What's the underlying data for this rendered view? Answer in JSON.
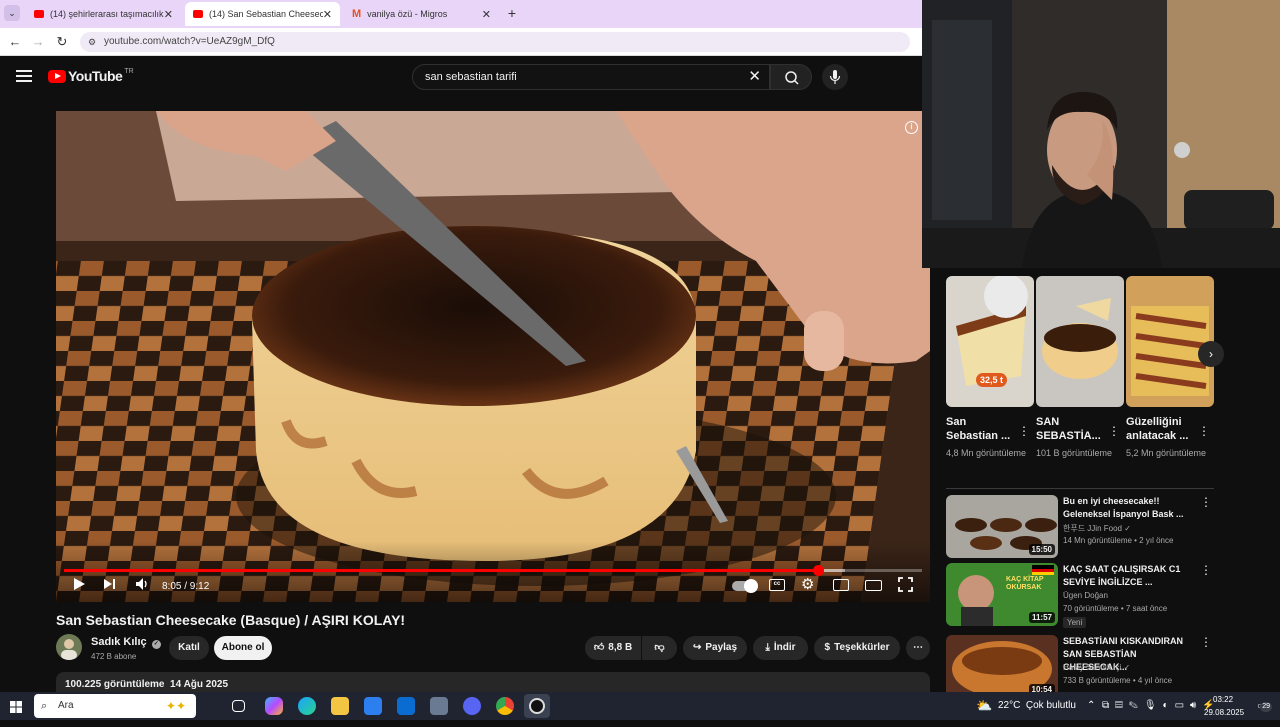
{
  "browser": {
    "tabs": [
      {
        "label": "(14) şehirlerarası taşımacılık - Y",
        "active": false
      },
      {
        "label": "(14) San Sebastian Cheesecake (B",
        "active": true
      },
      {
        "label": "vanilya özü - Migros",
        "active": false
      }
    ],
    "new_tab": "+",
    "url": "youtube.com/watch?v=UeAZ9gM_DfQ"
  },
  "youtube": {
    "logo_text": "YouTube",
    "country_code": "TR",
    "search_query": "san sebastian tarifi"
  },
  "player": {
    "time": "8:05 / 9:12",
    "progress": 0.879,
    "buffered": 0.91
  },
  "video": {
    "title": "San Sebastian Cheesecake (Basque) / AŞIRI KOLAY!",
    "channel": "Sadık Kılıç",
    "subscribers": "472 B abone",
    "join_label": "Katıl",
    "subscribe_label": "Abone ol",
    "likes": "8,8 B",
    "share_label": "Paylaş",
    "download_label": "İndir",
    "thanks_label": "Teşekkürler",
    "views_date": "100.225 görüntüleme  14 Ağu 2025"
  },
  "shorts": [
    {
      "title": "San Sebastian ...",
      "views": "4,8 Mn görüntüleme",
      "badge": "32,5 t"
    },
    {
      "title": "SAN SEBASTİA...",
      "views": "101 B görüntüleme"
    },
    {
      "title": "Güzelliğini anlatacak ...",
      "views": "5,2 Mn görüntüleme"
    }
  ],
  "recommended": [
    {
      "title": "Bu en iyi cheesecake!! Geleneksel İspanyol Bask ...",
      "channel": "한푸드 JJin Food",
      "meta": "14 Mn görüntüleme • 2 yıl önce",
      "duration": "15:50",
      "new": ""
    },
    {
      "title": "KAÇ SAAT ÇALIŞIRSAK C1 SEVİYE İNGİLİZCE ...",
      "channel": "Ügen Doğan",
      "meta": "70 görüntüleme • 7 saat önce",
      "duration": "11:57",
      "new": "Yeni",
      "thumb_text": "KAÇ KİTAP OKURSAK"
    },
    {
      "title": "SEBASTİANI KISKANDIRAN SAN SEBASTİAN CHEESECAK...",
      "channel": "Hatay Sandık İçi",
      "meta": "733 B görüntüleme • 4 yıl önce",
      "duration": "10:54",
      "new": ""
    }
  ],
  "taskbar": {
    "search_placeholder": "Ara",
    "weather": "22°C  Çok bulutlu",
    "time": "03:22",
    "date": "29.08.2025",
    "notifications": "29"
  }
}
